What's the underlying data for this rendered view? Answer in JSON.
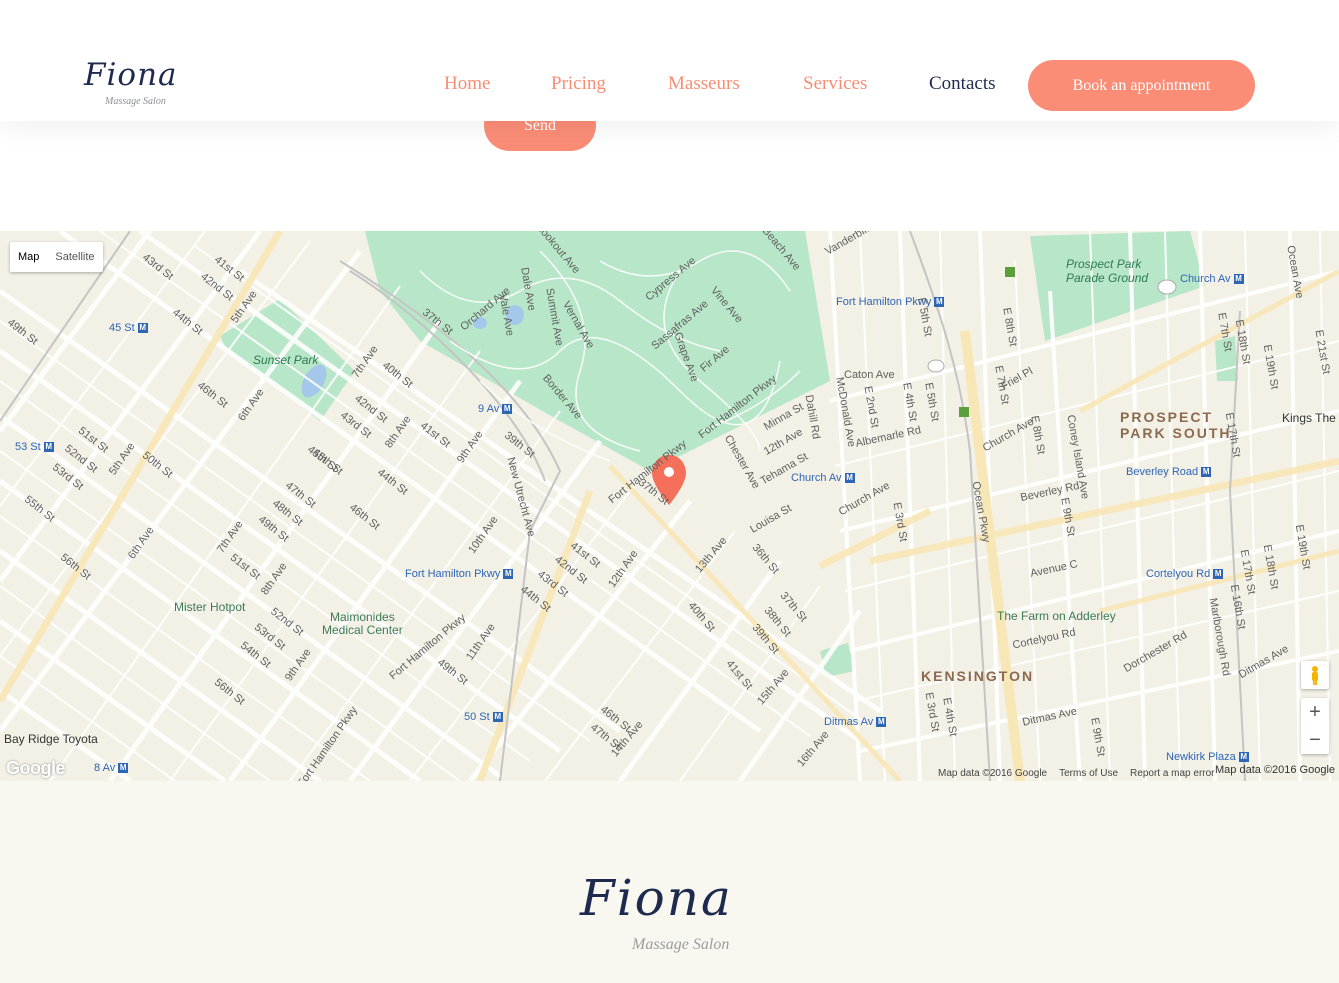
{
  "header": {
    "logo": {
      "word": "Fiona",
      "subtitle": "Massage Salon"
    },
    "nav": [
      {
        "label": "Home",
        "active": false
      },
      {
        "label": "Pricing",
        "active": false
      },
      {
        "label": "Masseurs",
        "active": false
      },
      {
        "label": "Services",
        "active": false
      },
      {
        "label": "Contacts",
        "active": true
      }
    ],
    "book_label": "Book an appointment"
  },
  "form": {
    "send_label": "Send"
  },
  "map": {
    "type_controls": {
      "map": "Map",
      "satellite": "Satellite",
      "selected": "Map"
    },
    "districts": [
      "PROSPECT\nPARK SOUTH",
      "KENSINGTON"
    ],
    "parks": [
      "Prospect Park\nParade Ground",
      "Sunset Park"
    ],
    "pois": [
      "Mister Hotpot",
      "Maimonides\nMedical Center",
      "The Farm on Adderley",
      "Bay Ridge Toyota",
      "Kings The"
    ],
    "stations": [
      "45 St",
      "53 St",
      "9 Av",
      "Fort Hamilton Pkwy",
      "Fort Hamilton Pkwy",
      "Church Av",
      "Church Av",
      "Beverley Road",
      "Cortelyou Rd",
      "Ditmas Av",
      "50 St",
      "8 Av",
      "Newkirk Plaza"
    ],
    "streets": [
      "43rd St",
      "42nd St",
      "41st St",
      "44th St",
      "49th St",
      "5th Ave",
      "7th Ave",
      "40th St",
      "46th St",
      "6th Ave",
      "42nd St",
      "43rd St",
      "8th Ave",
      "41st St",
      "9th Ave",
      "39th St",
      "45th St",
      "44th St",
      "47th St",
      "48th St",
      "46th St",
      "51st St",
      "52nd St",
      "53rd St",
      "50th St",
      "5th Ave",
      "55th St",
      "6th Ave",
      "56th St",
      "7th Ave",
      "49th St",
      "51st St",
      "8th Ave",
      "52nd St",
      "53rd St",
      "54th St",
      "9th Ave",
      "56th St",
      "10th Ave",
      "New Utrecht Ave",
      "41st St",
      "42nd St",
      "43rd St",
      "44th St",
      "12th Ave",
      "Fort Hamilton Pkwy",
      "11th Ave",
      "49th St",
      "Caton Ave",
      "McDonald Ave",
      "Dahill Rd",
      "E 2nd St",
      "E 4th St",
      "E 5th St",
      "Albemarle Rd",
      "12th Ave",
      "Minna St",
      "Tehama St",
      "Chester Ave",
      "Louisa St",
      "Church Ave",
      "E 3rd St",
      "36th St",
      "37th St",
      "38th St",
      "39th St",
      "40th St",
      "41st St",
      "13th Ave",
      "14th Ave",
      "15th Ave",
      "16th Ave",
      "E 7th St",
      "Friel Pl",
      "E 8th St",
      "Church Ave",
      "Coney Island Ave",
      "Beverley Rd",
      "E 9th St",
      "Ocean Pkwy",
      "Avenue C",
      "Cortelyou Rd",
      "Dorchester Rd",
      "E 4th St",
      "E 3rd St",
      "Ditmas Ave",
      "E 9th St",
      "E 18th St",
      "E 19th St",
      "E 17th St",
      "E 16th St",
      "Marlborough Rd",
      "Ocean Ave",
      "E 19th St",
      "E 18th St",
      "E 17th St",
      "E 21st St",
      "Ditmas Ave",
      "Vanderbilt St",
      "Beach Ave",
      "Cypress Ave",
      "Vine Ave",
      "Orchard Ave",
      "Dale Ave",
      "Lookout Ave",
      "Sassafras Ave",
      "Grape Ave",
      "Fir Ave",
      "Border Ave",
      "Summit Ave",
      "Vernal Ave",
      "Vale Ave",
      "37th St",
      "Fort Hamilton Pkwy",
      "Fort Hamilton Pkwy",
      "37th St",
      "E 5th St",
      "E 7th St",
      "E 8th St",
      "45th St",
      "46th St",
      "47th St",
      "Fort Hamilton Pkwy"
    ],
    "attribution": [
      "Map data ©2016 Google",
      "Terms of Use",
      "Report a map error"
    ],
    "attribution2": "Map data ©2016 Google",
    "google_logo": "Google",
    "zoom_in": "+",
    "zoom_out": "−"
  },
  "footer": {
    "logo": {
      "word": "Fiona",
      "subtitle": "Massage Salon"
    }
  },
  "colors": {
    "accent": "#fb8d77",
    "navy": "#1e2b4e",
    "park": "#b8e6c8",
    "map_bg": "#f3f0e6",
    "footer_bg": "#f9f8f0"
  }
}
